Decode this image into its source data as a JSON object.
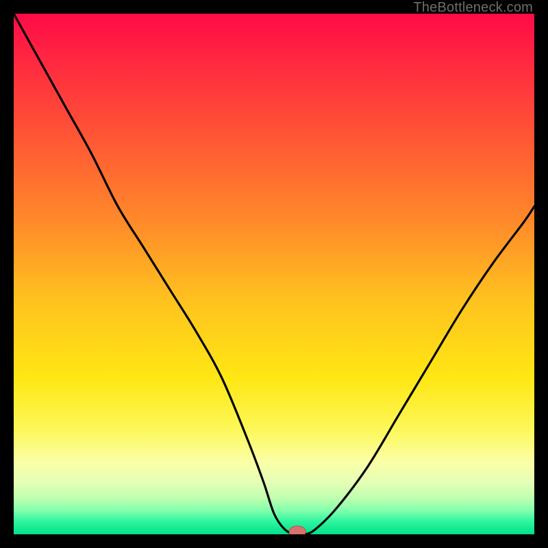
{
  "watermark": "TheBottleneck.com",
  "chart_data": {
    "type": "line",
    "title": "",
    "xlabel": "",
    "ylabel": "",
    "xlim": [
      0,
      100
    ],
    "ylim": [
      0,
      100
    ],
    "background_gradient": [
      {
        "offset": 0.0,
        "color": "#ff0b47"
      },
      {
        "offset": 0.1,
        "color": "#ff2b3f"
      },
      {
        "offset": 0.25,
        "color": "#ff5a34"
      },
      {
        "offset": 0.4,
        "color": "#ff8a2a"
      },
      {
        "offset": 0.55,
        "color": "#ffc21f"
      },
      {
        "offset": 0.7,
        "color": "#ffe714"
      },
      {
        "offset": 0.8,
        "color": "#fdf85a"
      },
      {
        "offset": 0.86,
        "color": "#fbffa6"
      },
      {
        "offset": 0.9,
        "color": "#e5ffb6"
      },
      {
        "offset": 0.93,
        "color": "#c0ffb0"
      },
      {
        "offset": 0.955,
        "color": "#80ffad"
      },
      {
        "offset": 0.975,
        "color": "#30f5a0"
      },
      {
        "offset": 1.0,
        "color": "#00e08a"
      }
    ],
    "series": [
      {
        "name": "bottleneck-curve",
        "color": "#000000",
        "x": [
          0,
          5,
          10,
          15,
          20,
          25,
          30,
          35,
          40,
          45,
          48,
          50,
          52,
          54,
          56,
          58,
          62,
          68,
          74,
          80,
          86,
          92,
          98,
          100
        ],
        "y": [
          100,
          91,
          82,
          73,
          63,
          55,
          47,
          39,
          30,
          18,
          10,
          4,
          1,
          0,
          0,
          1,
          5,
          13,
          23,
          33,
          43,
          52,
          60,
          63
        ]
      }
    ],
    "marker": {
      "name": "optimal-point",
      "x": 54.5,
      "y": 0.5,
      "rx": 1.6,
      "ry": 1.1,
      "fill": "#d6736f",
      "stroke": "#b6524e"
    }
  }
}
